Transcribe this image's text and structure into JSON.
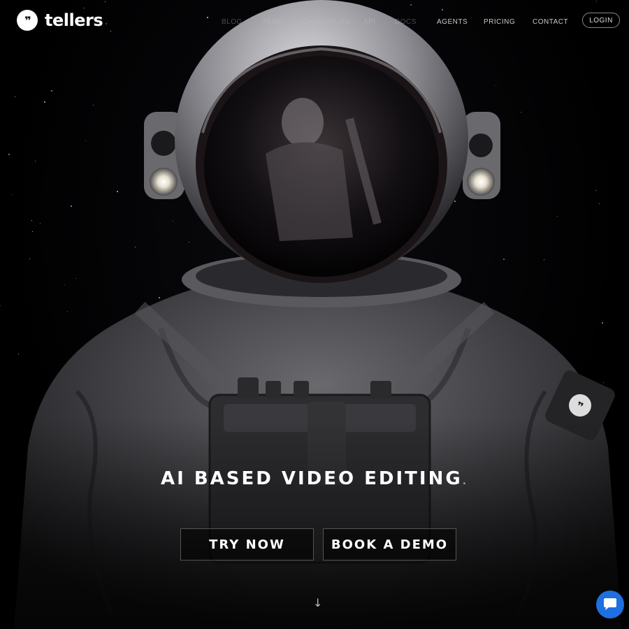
{
  "brand": {
    "name": "tellers",
    "mark": "❞"
  },
  "nav": {
    "items": [
      {
        "label": "BLOG",
        "faded": true
      },
      {
        "label": "TEAM",
        "faded": true
      },
      {
        "label": "CHANGELOG",
        "faded": true
      },
      {
        "label": "API",
        "faded": true
      },
      {
        "label": "DOCS",
        "faded": true
      },
      {
        "label": "AGENTS",
        "faded": false
      },
      {
        "label": "PRICING",
        "faded": false
      },
      {
        "label": "CONTACT",
        "faded": false
      }
    ],
    "login_label": "LOGIN"
  },
  "hero": {
    "title": "AI BASED VIDEO EDITING",
    "title_suffix": ".",
    "try_label": "TRY NOW",
    "demo_label": "BOOK A DEMO",
    "scroll_icon": "arrow-down-icon"
  },
  "chat": {
    "icon": "chat-bubble-icon",
    "color": "#1e6fe0"
  },
  "colors": {
    "background": "#000000",
    "text": "#ffffff",
    "nav_text": "#c8c8c8"
  }
}
